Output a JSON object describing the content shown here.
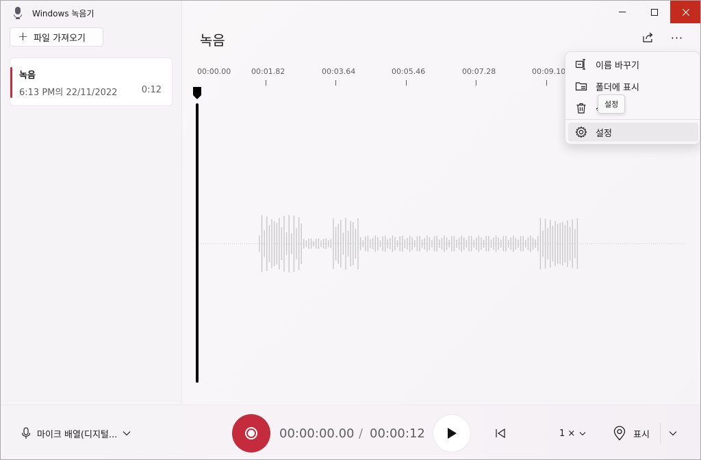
{
  "app": {
    "title": "Windows 녹음기",
    "icon": "microphone-icon"
  },
  "sidebar": {
    "import_label": "파일 가져오기",
    "recordings": [
      {
        "name": "녹음",
        "date": "6:13 PM의 22/11/2022",
        "duration": "0:12"
      }
    ]
  },
  "main": {
    "title": "녹음",
    "timeline_ticks": [
      "00:00.00",
      "00:01.82",
      "00:03.64",
      "00:05.46",
      "00:07.28",
      "00:09.10"
    ]
  },
  "menu": {
    "items": [
      {
        "label": "이름 바꾸기",
        "icon": "rename-icon"
      },
      {
        "label": "폴더에 표시",
        "icon": "folder-icon"
      },
      {
        "label": "삭제",
        "icon": "trash-icon"
      },
      {
        "label": "설정",
        "icon": "gear-icon"
      }
    ],
    "tooltip": "설정"
  },
  "bottom": {
    "mic_label": "마이크 배열(디지털...",
    "time_current": "00:00:00.00",
    "time_separator": "/",
    "time_total": "00:00:12",
    "speed": "1 ×",
    "marker_label": "표시"
  },
  "colors": {
    "accent": "#c42b3c",
    "close": "#c42b1c",
    "waveform": "#c8c8c8"
  }
}
